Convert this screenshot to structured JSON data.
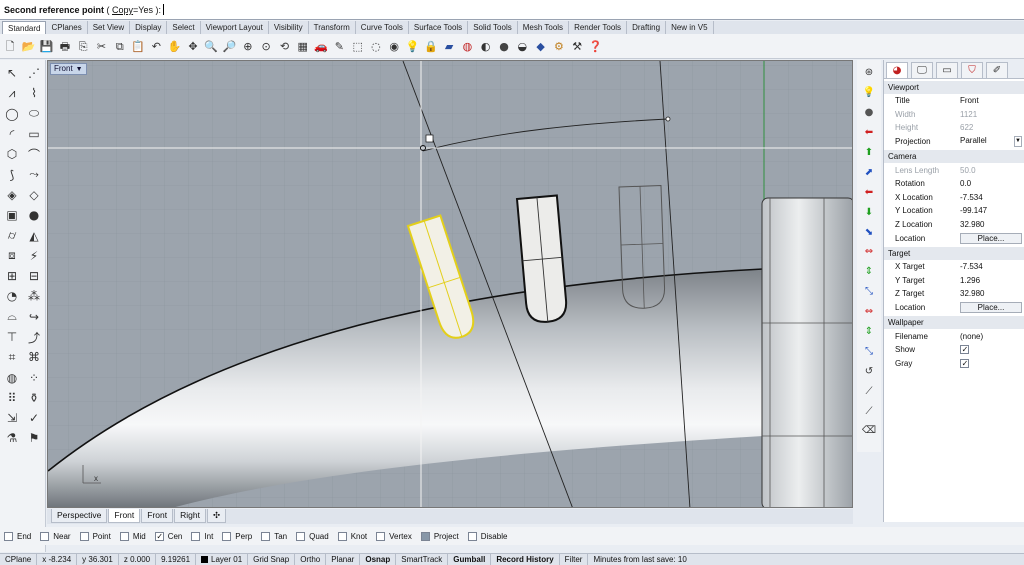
{
  "command": {
    "prompt": "Second reference point",
    "option_open": " ( ",
    "option_name": "Copy",
    "option_value": "=Yes",
    "option_close": " ):"
  },
  "tabs": [
    "Standard",
    "CPlanes",
    "Set View",
    "Display",
    "Select",
    "Viewport Layout",
    "Visibility",
    "Transform",
    "Curve Tools",
    "Surface Tools",
    "Solid Tools",
    "Mesh Tools",
    "Render Tools",
    "Drafting",
    "New in V5"
  ],
  "active_tab": "Standard",
  "toolbar_icons": [
    {
      "name": "new-file-icon",
      "glyph": "🗋",
      "color": "#333333"
    },
    {
      "name": "open-folder-icon",
      "glyph": "📂",
      "color": "#c89a2a"
    },
    {
      "name": "save-icon",
      "glyph": "💾",
      "color": "#2a4fa0"
    },
    {
      "name": "print-icon",
      "glyph": "🖶",
      "color": "#333333"
    },
    {
      "name": "import-icon",
      "glyph": "⎘",
      "color": "#333333"
    },
    {
      "name": "cut-icon",
      "glyph": "✂",
      "color": "#333333"
    },
    {
      "name": "copy-icon",
      "glyph": "⧉",
      "color": "#333333"
    },
    {
      "name": "paste-icon",
      "glyph": "📋",
      "color": "#c89a2a"
    },
    {
      "name": "undo-icon",
      "glyph": "↶",
      "color": "#333333"
    },
    {
      "name": "pan-hand-icon",
      "glyph": "✋",
      "color": "#333333"
    },
    {
      "name": "move-view-icon",
      "glyph": "✥",
      "color": "#333333"
    },
    {
      "name": "zoom-icon",
      "glyph": "🔍",
      "color": "#333333"
    },
    {
      "name": "zoom-window-icon",
      "glyph": "🔎",
      "color": "#333333"
    },
    {
      "name": "zoom-extents-icon",
      "glyph": "⊕",
      "color": "#333333"
    },
    {
      "name": "zoom-selected-icon",
      "glyph": "⊙",
      "color": "#333333"
    },
    {
      "name": "rotate-view-icon",
      "glyph": "⟲",
      "color": "#333333"
    },
    {
      "name": "four-viewports-icon",
      "glyph": "▦",
      "color": "#333333"
    },
    {
      "name": "car-icon",
      "glyph": "🚗",
      "color": "#c02020"
    },
    {
      "name": "edit-icon",
      "glyph": "✎",
      "color": "#333333"
    },
    {
      "name": "select-all-icon",
      "glyph": "⬚",
      "color": "#333333"
    },
    {
      "name": "hide-icon",
      "glyph": "◌",
      "color": "#333333"
    },
    {
      "name": "show-icon",
      "glyph": "◉",
      "color": "#333333"
    },
    {
      "name": "light-bulb-icon",
      "glyph": "💡",
      "color": "#c8a000"
    },
    {
      "name": "lock-icon",
      "glyph": "🔒",
      "color": "#333333"
    },
    {
      "name": "layer-icon",
      "glyph": "▰",
      "color": "#2a4fa0"
    },
    {
      "name": "color-wheel-icon",
      "glyph": "◍",
      "color": "#c02020"
    },
    {
      "name": "material-icon",
      "glyph": "◐",
      "color": "#333333"
    },
    {
      "name": "render-sphere-icon",
      "glyph": "●",
      "color": "#444444"
    },
    {
      "name": "render-icon",
      "glyph": "◒",
      "color": "#333333"
    },
    {
      "name": "environment-icon",
      "glyph": "◆",
      "color": "#2a4fa0"
    },
    {
      "name": "options-gear-icon",
      "glyph": "⚙",
      "color": "#c08020"
    },
    {
      "name": "settings-icon",
      "glyph": "⚒",
      "color": "#333333"
    },
    {
      "name": "help-icon",
      "glyph": "❓",
      "color": "#2a4fa0"
    }
  ],
  "left_toolbar_icons": [
    {
      "name": "select-arrow-icon",
      "glyph": "↖"
    },
    {
      "name": "select-points-icon",
      "glyph": "⋰"
    },
    {
      "name": "polyline-icon",
      "glyph": "⩘"
    },
    {
      "name": "curve-icon",
      "glyph": "⌇"
    },
    {
      "name": "circle-icon",
      "glyph": "◯"
    },
    {
      "name": "ellipse-icon",
      "glyph": "⬭"
    },
    {
      "name": "arc-icon",
      "glyph": "◜"
    },
    {
      "name": "rectangle-icon",
      "glyph": "▭"
    },
    {
      "name": "polygon-icon",
      "glyph": "⬡"
    },
    {
      "name": "fillet-curve-icon",
      "glyph": "⌒"
    },
    {
      "name": "offset-curve-icon",
      "glyph": "⟆"
    },
    {
      "name": "extend-icon",
      "glyph": "⤳"
    },
    {
      "name": "surface-from-points-icon",
      "glyph": "◈"
    },
    {
      "name": "loft-icon",
      "glyph": "◇"
    },
    {
      "name": "box-icon",
      "glyph": "▣"
    },
    {
      "name": "sphere-icon",
      "glyph": "●"
    },
    {
      "name": "cylinder-icon",
      "glyph": "⌭"
    },
    {
      "name": "cone-icon",
      "glyph": "◭"
    },
    {
      "name": "boolean-union-icon",
      "glyph": "⧈"
    },
    {
      "name": "boolean-split-icon",
      "glyph": "⚡"
    },
    {
      "name": "mesh-icon",
      "glyph": "⊞"
    },
    {
      "name": "mesh-edit-icon",
      "glyph": "⊟"
    },
    {
      "name": "fillet-icon",
      "glyph": "◔"
    },
    {
      "name": "chamfer-icon",
      "glyph": "⁂"
    },
    {
      "name": "join-icon",
      "glyph": "⌓"
    },
    {
      "name": "explode-icon",
      "glyph": "↪"
    },
    {
      "name": "trim-icon",
      "glyph": "⊤"
    },
    {
      "name": "split-icon",
      "glyph": "⤴"
    },
    {
      "name": "group-icon",
      "glyph": "⌗"
    },
    {
      "name": "ungroup-icon",
      "glyph": "⌘"
    },
    {
      "name": "move-icon",
      "glyph": "◍"
    },
    {
      "name": "copy-transform-icon",
      "glyph": "⁘"
    },
    {
      "name": "array-icon",
      "glyph": "⠿"
    },
    {
      "name": "orient-icon",
      "glyph": "⚱"
    },
    {
      "name": "dimension-icon",
      "glyph": "⇲"
    },
    {
      "name": "check-icon",
      "glyph": "✓"
    },
    {
      "name": "analyze-icon",
      "glyph": "⚗"
    },
    {
      "name": "properties-icon",
      "glyph": "⚑"
    }
  ],
  "viewport": {
    "title": "Front",
    "axis_x": "x",
    "axis_y": "z"
  },
  "viewport_tabs": [
    "Perspective",
    "Front",
    "Front",
    "Right"
  ],
  "active_viewport_tab": 1,
  "viewport_tab_add": "✣",
  "osnap": [
    {
      "label": "End",
      "checked": false
    },
    {
      "label": "Near",
      "checked": false
    },
    {
      "label": "Point",
      "checked": false
    },
    {
      "label": "Mid",
      "checked": false
    },
    {
      "label": "Cen",
      "checked": true
    },
    {
      "label": "Int",
      "checked": false
    },
    {
      "label": "Perp",
      "checked": false
    },
    {
      "label": "Tan",
      "checked": false
    },
    {
      "label": "Quad",
      "checked": false
    },
    {
      "label": "Knot",
      "checked": false
    },
    {
      "label": "Vertex",
      "checked": false
    },
    {
      "label": "Project",
      "checked": false,
      "filled": true
    },
    {
      "label": "Disable",
      "checked": false
    }
  ],
  "status": {
    "cplane": "CPlane",
    "x": "x -8.234",
    "y": "y 36.301",
    "z": "z 0.000",
    "distance": "9.19261",
    "layer": "Layer 01",
    "toggles": [
      {
        "label": "Grid Snap",
        "bold": false
      },
      {
        "label": "Ortho",
        "bold": false
      },
      {
        "label": "Planar",
        "bold": false
      },
      {
        "label": "Osnap",
        "bold": true
      },
      {
        "label": "SmartTrack",
        "bold": false
      },
      {
        "label": "Gumball",
        "bold": true
      },
      {
        "label": "Record History",
        "bold": true
      },
      {
        "label": "Filter",
        "bold": false
      }
    ],
    "autosave": "Minutes from last save: 10"
  },
  "right_toolbar_icons": [
    {
      "name": "view-icon",
      "glyph": "⊛",
      "color": "#333333"
    },
    {
      "name": "light-icon",
      "glyph": "💡",
      "color": "#888888"
    },
    {
      "name": "sphere-render-icon",
      "glyph": "●",
      "color": "#555555"
    },
    {
      "name": "arrow-left-icon",
      "glyph": "⬅",
      "color": "#d02020"
    },
    {
      "name": "arrow-up-icon",
      "glyph": "⬆",
      "color": "#20a020"
    },
    {
      "name": "arrow-up-right-icon",
      "glyph": "⬈",
      "color": "#2050c0"
    },
    {
      "name": "arrow-left-2-icon",
      "glyph": "⬅",
      "color": "#d02020"
    },
    {
      "name": "arrow-down-icon",
      "glyph": "⬇",
      "color": "#20a020"
    },
    {
      "name": "arrow-down-right-icon",
      "glyph": "⬊",
      "color": "#2050c0"
    },
    {
      "name": "arrow-both-icon",
      "glyph": "⇔",
      "color": "#d02020"
    },
    {
      "name": "arrow-vertical-icon",
      "glyph": "⇕",
      "color": "#20a020"
    },
    {
      "name": "arrow-diagonal-icon",
      "glyph": "⤡",
      "color": "#2050c0"
    },
    {
      "name": "arrow-both-2-icon",
      "glyph": "⇔",
      "color": "#d02020"
    },
    {
      "name": "arrow-vertical-2-icon",
      "glyph": "⇕",
      "color": "#20a020"
    },
    {
      "name": "arrow-diagonal-2-icon",
      "glyph": "⤡",
      "color": "#2050c0"
    },
    {
      "name": "rotate-icon",
      "glyph": "↺",
      "color": "#333333"
    },
    {
      "name": "line-icon",
      "glyph": "⟋",
      "color": "#333333"
    },
    {
      "name": "line-2-icon",
      "glyph": "⟋",
      "color": "#333333"
    },
    {
      "name": "eraser-icon",
      "glyph": "⌫",
      "color": "#333333"
    }
  ],
  "panel": {
    "tab_icons": [
      {
        "name": "properties-color-icon",
        "glyph": "◕",
        "color": "#c02020"
      },
      {
        "name": "display-icon",
        "glyph": "🖵",
        "color": "#333333"
      },
      {
        "name": "monitor-icon",
        "glyph": "▭",
        "color": "#333333"
      },
      {
        "name": "render-teapot-icon",
        "glyph": "⛉",
        "color": "#c02020"
      },
      {
        "name": "pen-tool-icon",
        "glyph": "✐",
        "color": "#333333"
      }
    ],
    "sections": [
      {
        "title": "Viewport",
        "rows": [
          {
            "label": "Title",
            "value": "Front",
            "type": "text"
          },
          {
            "label": "Width",
            "value": "1121",
            "type": "text",
            "disabled": true
          },
          {
            "label": "Height",
            "value": "622",
            "type": "text",
            "disabled": true
          },
          {
            "label": "Projection",
            "value": "Parallel",
            "type": "select"
          }
        ]
      },
      {
        "title": "Camera",
        "rows": [
          {
            "label": "Lens Length",
            "value": "50.0",
            "type": "text",
            "disabled": true
          },
          {
            "label": "Rotation",
            "value": "0.0",
            "type": "text"
          },
          {
            "label": "X Location",
            "value": "-7.534",
            "type": "text"
          },
          {
            "label": "Y Location",
            "value": "-99.147",
            "type": "text"
          },
          {
            "label": "Z Location",
            "value": "32.980",
            "type": "text"
          },
          {
            "label": "Location",
            "value": "Place...",
            "type": "button"
          }
        ]
      },
      {
        "title": "Target",
        "rows": [
          {
            "label": "X Target",
            "value": "-7.534",
            "type": "text"
          },
          {
            "label": "Y Target",
            "value": "1.296",
            "type": "text"
          },
          {
            "label": "Z Target",
            "value": "32.980",
            "type": "text"
          },
          {
            "label": "Location",
            "value": "Place...",
            "type": "button"
          }
        ]
      },
      {
        "title": "Wallpaper",
        "rows": [
          {
            "label": "Filename",
            "value": "(none)",
            "type": "text"
          },
          {
            "label": "Show",
            "value": true,
            "type": "checkbox"
          },
          {
            "label": "Gray",
            "value": true,
            "type": "checkbox"
          }
        ]
      }
    ]
  }
}
